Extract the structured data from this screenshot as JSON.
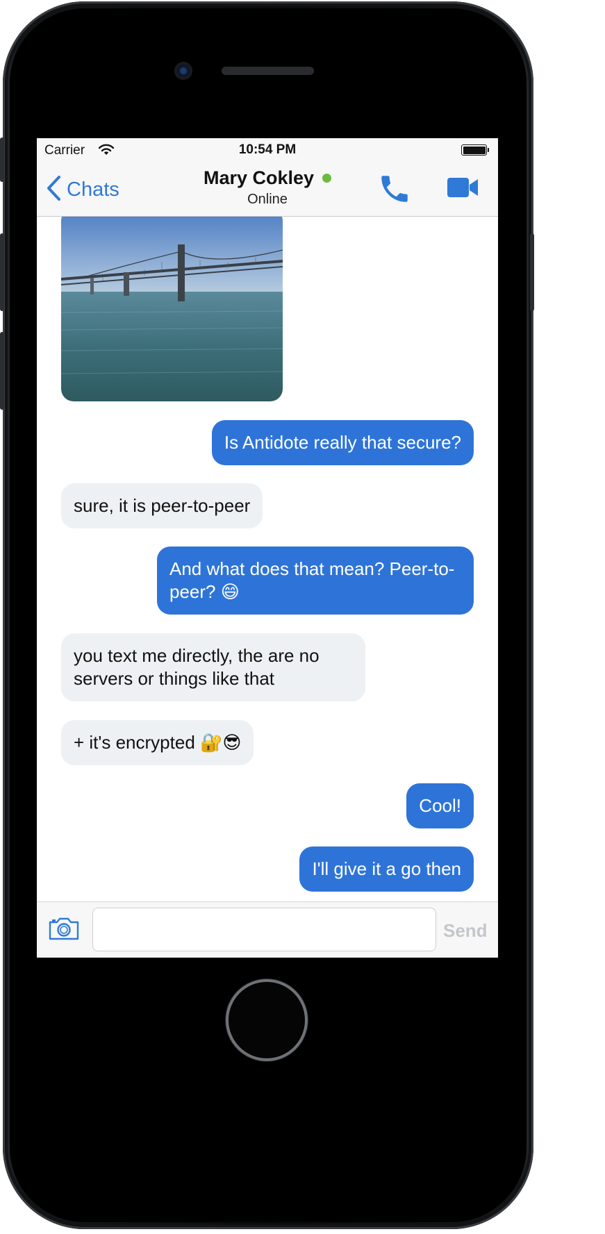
{
  "status_bar": {
    "carrier": "Carrier",
    "time": "10:54 PM"
  },
  "nav": {
    "back_label": "Chats",
    "contact_name": "Mary Cokley",
    "contact_status": "Online",
    "online_color": "#6cbb3c",
    "call_icon": "phone-icon",
    "video_icon": "video-camera-icon"
  },
  "messages": [
    {
      "type": "image",
      "direction": "incoming",
      "subject": "bridge-over-water-photo"
    },
    {
      "type": "text",
      "direction": "outgoing",
      "text": "Is Antidote really that secure?"
    },
    {
      "type": "text",
      "direction": "incoming",
      "text": "sure, it is peer-to-peer"
    },
    {
      "type": "text",
      "direction": "outgoing",
      "text": "And what does that mean? Peer-to-peer? 😄"
    },
    {
      "type": "text",
      "direction": "incoming",
      "text": "you text me directly, the are no servers or things like that"
    },
    {
      "type": "text",
      "direction": "incoming",
      "text": "+ it's encrypted 🔐😎"
    },
    {
      "type": "text",
      "direction": "outgoing",
      "text": "Cool!"
    },
    {
      "type": "text",
      "direction": "outgoing",
      "text": "I'll give it a go then"
    }
  ],
  "composer": {
    "value": "",
    "send_label": "Send",
    "camera_icon": "camera-icon"
  },
  "colors": {
    "accent": "#2f7ad6",
    "outgoing_bubble": "#2e74d8",
    "incoming_bubble": "#eef1f4"
  }
}
